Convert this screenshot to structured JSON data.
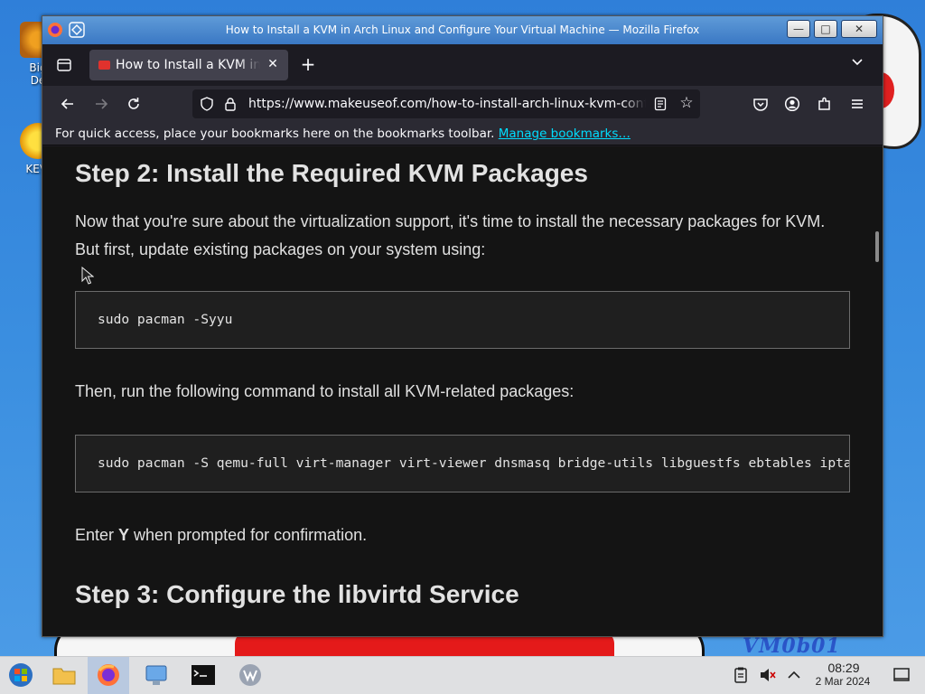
{
  "window": {
    "title": "How to Install a KVM in Arch Linux and Configure Your Virtual Machine — Mozilla Firefox"
  },
  "tab": {
    "label": "How to Install a KVM in Arch Linux and Configure Your Virtual Machine"
  },
  "navigation": {
    "url": "https://www.makeuseof.com/how-to-install-arch-linux-kvm-configure-vm/"
  },
  "bookmarks_bar": {
    "message": "For quick access, place your bookmarks here on the bookmarks toolbar.",
    "link": "Manage bookmarks…"
  },
  "article": {
    "step2_heading": "Step 2: Install the Required KVM Packages",
    "para1": "Now that you're sure about the virtualization support, it's time to install the necessary packages for KVM. But first, update existing packages on your system using:",
    "code1": "sudo pacman -Syyu",
    "para2": "Then, run the following command to install all KVM-related packages:",
    "code2": "sudo pacman -S qemu-full virt-manager virt-viewer dnsmasq bridge-utils libguestfs ebtables iptables-nft",
    "para3_prefix": "Enter ",
    "para3_bold": "Y",
    "para3_suffix": " when prompted for confirmation.",
    "step3_heading": "Step 3: Configure the libvirtd Service"
  },
  "desktop": {
    "icon1_label": "Big\nDe",
    "icon2_label": "KEVI",
    "wallpaper_text": "VM0b01"
  },
  "taskbar": {
    "time": "08:29",
    "date": "2 Mar 2024"
  },
  "colors": {
    "titlebar": "#3a78c4",
    "page_background": "#141414",
    "link": "#00ddff"
  }
}
